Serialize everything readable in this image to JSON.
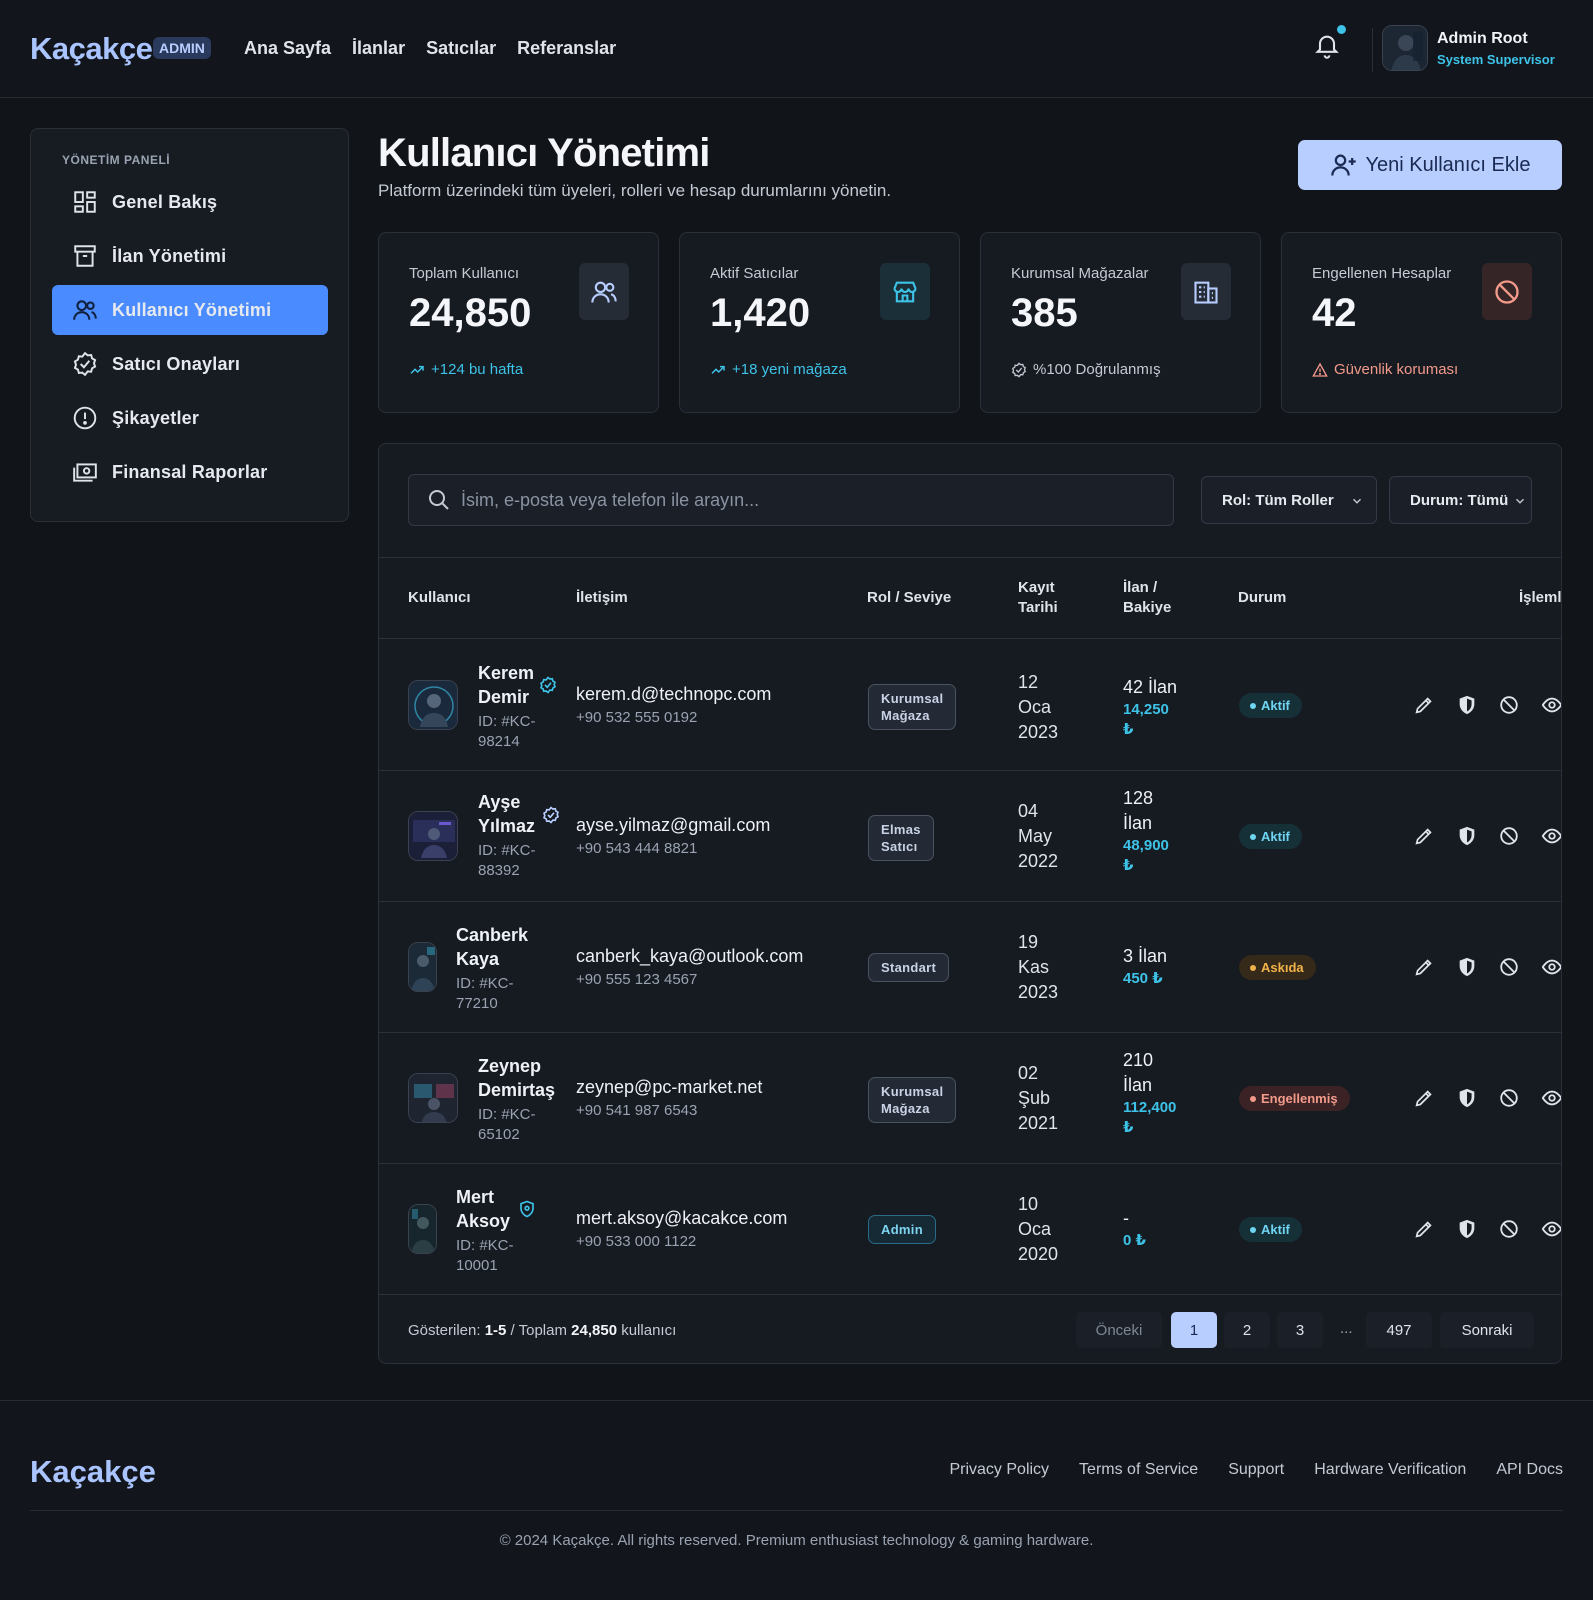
{
  "header": {
    "logo": "Kaçakçe",
    "badge": "ADMIN",
    "nav": [
      "Ana Sayfa",
      "İlanlar",
      "Satıcılar",
      "Referanslar"
    ],
    "user_name": "Admin Root",
    "user_role": "System Supervisor"
  },
  "sidebar": {
    "title": "YÖNETİM PANELİ",
    "items": [
      {
        "label": "Genel Bakış",
        "icon": "dashboard-icon"
      },
      {
        "label": "İlan Yönetimi",
        "icon": "archive-icon"
      },
      {
        "label": "Kullanıcı Yönetimi",
        "icon": "users-icon",
        "active": true
      },
      {
        "label": "Satıcı Onayları",
        "icon": "verified-icon"
      },
      {
        "label": "Şikayetler",
        "icon": "alert-circle-icon"
      },
      {
        "label": "Finansal Raporlar",
        "icon": "money-icon"
      }
    ]
  },
  "page": {
    "title": "Kullanıcı Yönetimi",
    "subtitle": "Platform üzerindeki tüm üyeleri, rolleri ve hesap durumlarını yönetin.",
    "new_button": "Yeni Kullanıcı Ekle"
  },
  "stats": [
    {
      "label": "Toplam Kullanıcı",
      "value": "24,850",
      "foot": "+124 bu hafta",
      "icon": "users-icon",
      "foot_color": "#3ec3e8"
    },
    {
      "label": "Aktif Satıcılar",
      "value": "1,420",
      "foot": "+18 yeni mağaza",
      "icon": "store-icon",
      "foot_color": "#3ec3e8"
    },
    {
      "label": "Kurumsal Mağazalar",
      "value": "385",
      "foot": "%100 Doğrulanmış",
      "icon": "building-icon",
      "foot_color": "#c4cad4"
    },
    {
      "label": "Engellenen Hesaplar",
      "value": "42",
      "foot": "Güvenlik koruması",
      "icon": "block-icon",
      "foot_color": "#f39a8a"
    }
  ],
  "filters": {
    "search_placeholder": "İsim, e-posta veya telefon ile arayın...",
    "role": "Rol: Tüm Roller",
    "status": "Durum: Tümü"
  },
  "table": {
    "headers": {
      "user": "Kullanıcı",
      "contact": "İletişim",
      "role": "Rol / Seviye",
      "date_1": "Kayıt",
      "date_2": "Tarihi",
      "listing_1": "İlan /",
      "listing_2": "Bakiye",
      "status": "Durum",
      "actions": "İşlemler"
    },
    "rows": [
      {
        "name_1": "Kerem",
        "name_2": "Demir",
        "id_1": "ID: #KC-",
        "id_2": "98214",
        "email": "kerem.d@technopc.com",
        "phone": "+90 532 555 0192",
        "role_1": "Kurumsal",
        "role_2": "Mağaza",
        "date_1": "12",
        "date_2": "Oca",
        "date_3": "2023",
        "list_1": "42 İlan",
        "list_2": "",
        "bal_1": "14,250",
        "bal_2": "₺",
        "status": "Aktif"
      },
      {
        "name_1": "Ayşe",
        "name_2": "Yılmaz",
        "id_1": "ID: #KC-",
        "id_2": "88392",
        "email": "ayse.yilmaz@gmail.com",
        "phone": "+90 543 444 8821",
        "role_1": "Elmas",
        "role_2": "Satıcı",
        "date_1": "04",
        "date_2": "May",
        "date_3": "2022",
        "list_1": "128",
        "list_2": "İlan",
        "bal_1": "48,900",
        "bal_2": "₺",
        "status": "Aktif"
      },
      {
        "name_1": "Canberk",
        "name_2": "Kaya",
        "id_1": "ID: #KC-",
        "id_2": "77210",
        "email": "canberk_kaya@outlook.com",
        "phone": "+90 555 123 4567",
        "role_1": "Standart",
        "role_2": "",
        "date_1": "19",
        "date_2": "Kas",
        "date_3": "2023",
        "list_1": "3 İlan",
        "list_2": "",
        "bal_1": "450 ₺",
        "bal_2": "",
        "status": "Askıda"
      },
      {
        "name_1": "Zeynep",
        "name_2": "Demirtaş",
        "id_1": "ID: #KC-",
        "id_2": "65102",
        "email": "zeynep@pc-market.net",
        "phone": "+90 541 987 6543",
        "role_1": "Kurumsal",
        "role_2": "Mağaza",
        "date_1": "02",
        "date_2": "Şub",
        "date_3": "2021",
        "list_1": "210",
        "list_2": "İlan",
        "bal_1": "112,400",
        "bal_2": "₺",
        "status": "Engellenmiş"
      },
      {
        "name_1": "Mert",
        "name_2": "Aksoy",
        "id_1": "ID: #KC-",
        "id_2": "10001",
        "email": "mert.aksoy@kacakce.com",
        "phone": "+90 533 000 1122",
        "role_1": "Admin",
        "role_2": "",
        "date_1": "10",
        "date_2": "Oca",
        "date_3": "2020",
        "list_1": "-",
        "list_2": "",
        "bal_1": "0 ₺",
        "bal_2": "",
        "status": "Aktif"
      }
    ]
  },
  "pagination": {
    "info_prefix": "Gösterilen: ",
    "info_range": "1-5",
    "info_mid": " / Toplam ",
    "info_total": "24,850",
    "info_suffix": " kullanıcı",
    "prev": "Önceki",
    "pages": [
      "1",
      "2",
      "3"
    ],
    "dots": "...",
    "last": "497",
    "next": "Sonraki"
  },
  "footer": {
    "logo": "Kaçakçe",
    "links": [
      "Privacy Policy",
      "Terms of Service",
      "Support",
      "Hardware Verification",
      "API Docs"
    ],
    "copyright": "© 2024 Kaçakçe. All rights reserved. Premium enthusiast technology & gaming hardware."
  },
  "colors": {
    "accent": "#4a8cff",
    "accent_light": "#b7ceff",
    "cyan": "#3ec3e8",
    "danger": "#f39a8a",
    "warning": "#f2b24a"
  }
}
